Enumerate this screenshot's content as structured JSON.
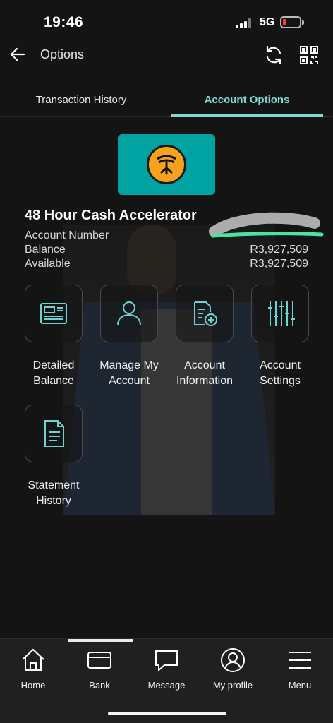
{
  "status": {
    "time": "19:46",
    "network": "5G"
  },
  "header": {
    "title": "Options"
  },
  "tabs": [
    {
      "label": "Transaction History",
      "active": false
    },
    {
      "label": "Account Options",
      "active": true
    }
  ],
  "account": {
    "name": "48 Hour Cash Accelerator",
    "number_label": "Account Number",
    "balance_label": "Balance",
    "balance_value": "R3,927,509",
    "available_label": "Available",
    "available_value": "R3,927,509"
  },
  "options": [
    {
      "label": "Detailed\nBalance",
      "icon": "detailed-balance-icon"
    },
    {
      "label": "Manage My\nAccount",
      "icon": "manage-account-icon"
    },
    {
      "label": "Account\nInformation",
      "icon": "account-information-icon"
    },
    {
      "label": "Account\nSettings",
      "icon": "settings-sliders-icon"
    },
    {
      "label": "Statement\nHistory",
      "icon": "statement-document-icon"
    }
  ],
  "nav": [
    {
      "label": "Home",
      "icon": "home-icon"
    },
    {
      "label": "Bank",
      "icon": "bank-card-icon"
    },
    {
      "label": "Message",
      "icon": "message-icon"
    },
    {
      "label": "My profile",
      "icon": "profile-icon"
    },
    {
      "label": "Menu",
      "icon": "menu-icon"
    }
  ],
  "colors": {
    "accent": "#7ed8d6",
    "brand": "#00a3a1",
    "logo_orange": "#f6a21e",
    "battery_low": "#ff3b30"
  }
}
